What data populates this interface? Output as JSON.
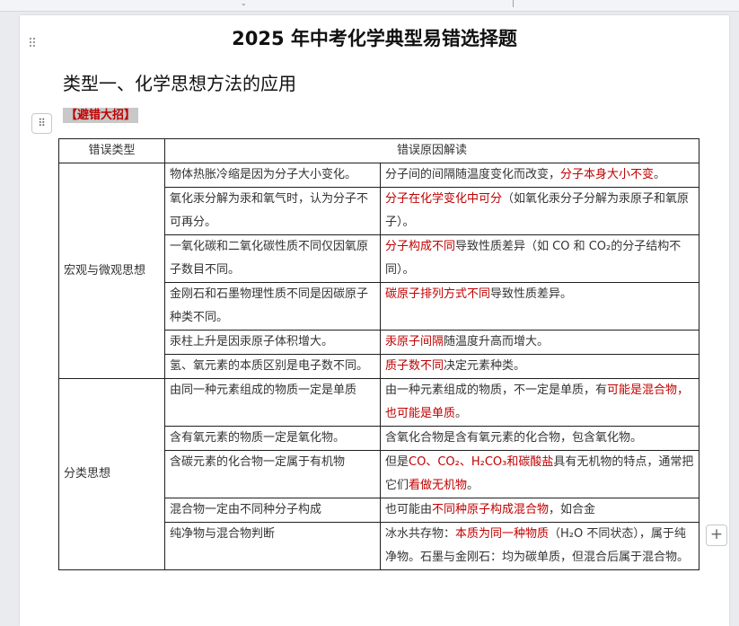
{
  "document": {
    "title": "2025 年中考化学典型易错选择题",
    "section_heading": "类型一、化学思想方法的应用",
    "tip_label": "【避错大招】"
  },
  "table": {
    "headers": [
      "错误类型",
      "错误原因解读"
    ],
    "groups": [
      {
        "category": "宏观与微观思想",
        "rows": [
          {
            "error": "物体热胀冷缩是因为分子大小变化。",
            "reason": [
              {
                "t": "分子间的间隔随温度变化而改变，"
              },
              {
                "t": "分子本身大小不变",
                "red": true
              },
              {
                "t": "。"
              }
            ]
          },
          {
            "error": "氧化汞分解为汞和氧气时，认为分子不可再分。",
            "reason": [
              {
                "t": "分子在化学变化中可分",
                "red": true
              },
              {
                "t": "（如氧化汞分子分解为汞原子和氧原子）。"
              }
            ]
          },
          {
            "error": "一氧化碳和二氧化碳性质不同仅因氧原子数目不同。",
            "reason": [
              {
                "t": "分子构成不同",
                "red": true
              },
              {
                "t": "导致性质差异（如 CO 和 CO₂的分子结构不同）。"
              }
            ]
          },
          {
            "error": "金刚石和石墨物理性质不同是因碳原子种类不同。",
            "reason": [
              {
                "t": "碳原子排列方式不同",
                "red": true
              },
              {
                "t": "导致性质差异。"
              }
            ]
          },
          {
            "error": "汞柱上升是因汞原子体积增大。",
            "reason": [
              {
                "t": "汞原子间隔",
                "red": true
              },
              {
                "t": "随温度升高而增大。"
              }
            ]
          },
          {
            "error": "氢、氧元素的本质区别是电子数不同。",
            "reason": [
              {
                "t": "质子数不同",
                "red": true
              },
              {
                "t": "决定元素种类。"
              }
            ]
          }
        ]
      },
      {
        "category": "分类思想",
        "rows": [
          {
            "error": "由同一种元素组成的物质一定是单质",
            "reason": [
              {
                "t": "由一种元素组成的物质，不一定是单质，有"
              },
              {
                "t": "可能是混合物，也可能是单质",
                "red": true
              },
              {
                "t": "。"
              }
            ]
          },
          {
            "error": "含有氧元素的物质一定是氧化物。",
            "reason": [
              {
                "t": "含氧化合物是含有氧元素的化合物，包含氧化物。"
              }
            ]
          },
          {
            "error": "含碳元素的化合物一定属于有机物",
            "reason": [
              {
                "t": "但是"
              },
              {
                "t": "CO、CO₂、H₂CO₃和碳酸盐",
                "red": true
              },
              {
                "t": "具有无机物的特点，通常把它们"
              },
              {
                "t": "看做无机物",
                "red": true
              },
              {
                "t": "。"
              }
            ]
          },
          {
            "error": "混合物一定由不同种分子构成",
            "reason": [
              {
                "t": "也可能由"
              },
              {
                "t": "不同种原子构成混合物",
                "red": true
              },
              {
                "t": "，如合金"
              }
            ]
          },
          {
            "error": "纯净物与混合物判断",
            "reason": [
              {
                "t": "冰水共存物："
              },
              {
                "t": "本质为同一种物质",
                "red": true
              },
              {
                "t": "（H₂O 不同状态），属于纯净物。石墨与金刚石：均为碳单质，但混合后属于混合物。"
              }
            ]
          }
        ]
      }
    ]
  },
  "colors": {
    "emphasis": "#c00000",
    "tip_background": "#c8c8c8"
  },
  "icons": [
    "drag-handle-icon",
    "block-menu-icon",
    "add-row-icon"
  ]
}
